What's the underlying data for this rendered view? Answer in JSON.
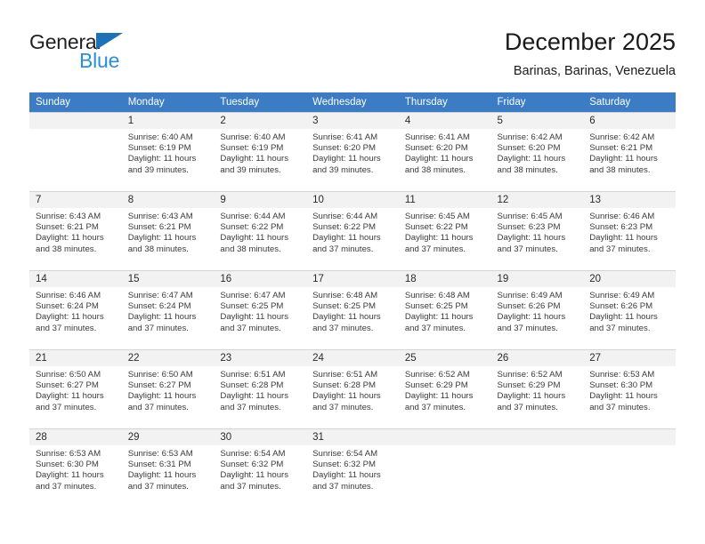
{
  "logo": {
    "word_one": "General",
    "word_two": "Blue",
    "triangle_icon": "blue-triangle-icon",
    "colors": {
      "dark": "#231f20",
      "blue": "#2a8fd8",
      "triangle": "#1b72b8"
    }
  },
  "header": {
    "title": "December 2025",
    "subtitle": "Barinas, Barinas, Venezuela"
  },
  "theme": {
    "header_row_bg": "#3b7cc4",
    "header_row_text": "#ffffff",
    "daynum_band_bg": "#f2f2f2",
    "cell_bg": "#ffffff",
    "grid_line": "#d4d4d4"
  },
  "calendar": {
    "weekday_headers": [
      "Sunday",
      "Monday",
      "Tuesday",
      "Wednesday",
      "Thursday",
      "Friday",
      "Saturday"
    ],
    "weeks": [
      [
        {
          "day": "",
          "sunrise": "",
          "sunset": "",
          "daylight_line1": "",
          "daylight_line2": ""
        },
        {
          "day": "1",
          "sunrise": "Sunrise: 6:40 AM",
          "sunset": "Sunset: 6:19 PM",
          "daylight_line1": "Daylight: 11 hours",
          "daylight_line2": "and 39 minutes."
        },
        {
          "day": "2",
          "sunrise": "Sunrise: 6:40 AM",
          "sunset": "Sunset: 6:19 PM",
          "daylight_line1": "Daylight: 11 hours",
          "daylight_line2": "and 39 minutes."
        },
        {
          "day": "3",
          "sunrise": "Sunrise: 6:41 AM",
          "sunset": "Sunset: 6:20 PM",
          "daylight_line1": "Daylight: 11 hours",
          "daylight_line2": "and 39 minutes."
        },
        {
          "day": "4",
          "sunrise": "Sunrise: 6:41 AM",
          "sunset": "Sunset: 6:20 PM",
          "daylight_line1": "Daylight: 11 hours",
          "daylight_line2": "and 38 minutes."
        },
        {
          "day": "5",
          "sunrise": "Sunrise: 6:42 AM",
          "sunset": "Sunset: 6:20 PM",
          "daylight_line1": "Daylight: 11 hours",
          "daylight_line2": "and 38 minutes."
        },
        {
          "day": "6",
          "sunrise": "Sunrise: 6:42 AM",
          "sunset": "Sunset: 6:21 PM",
          "daylight_line1": "Daylight: 11 hours",
          "daylight_line2": "and 38 minutes."
        }
      ],
      [
        {
          "day": "7",
          "sunrise": "Sunrise: 6:43 AM",
          "sunset": "Sunset: 6:21 PM",
          "daylight_line1": "Daylight: 11 hours",
          "daylight_line2": "and 38 minutes."
        },
        {
          "day": "8",
          "sunrise": "Sunrise: 6:43 AM",
          "sunset": "Sunset: 6:21 PM",
          "daylight_line1": "Daylight: 11 hours",
          "daylight_line2": "and 38 minutes."
        },
        {
          "day": "9",
          "sunrise": "Sunrise: 6:44 AM",
          "sunset": "Sunset: 6:22 PM",
          "daylight_line1": "Daylight: 11 hours",
          "daylight_line2": "and 38 minutes."
        },
        {
          "day": "10",
          "sunrise": "Sunrise: 6:44 AM",
          "sunset": "Sunset: 6:22 PM",
          "daylight_line1": "Daylight: 11 hours",
          "daylight_line2": "and 37 minutes."
        },
        {
          "day": "11",
          "sunrise": "Sunrise: 6:45 AM",
          "sunset": "Sunset: 6:22 PM",
          "daylight_line1": "Daylight: 11 hours",
          "daylight_line2": "and 37 minutes."
        },
        {
          "day": "12",
          "sunrise": "Sunrise: 6:45 AM",
          "sunset": "Sunset: 6:23 PM",
          "daylight_line1": "Daylight: 11 hours",
          "daylight_line2": "and 37 minutes."
        },
        {
          "day": "13",
          "sunrise": "Sunrise: 6:46 AM",
          "sunset": "Sunset: 6:23 PM",
          "daylight_line1": "Daylight: 11 hours",
          "daylight_line2": "and 37 minutes."
        }
      ],
      [
        {
          "day": "14",
          "sunrise": "Sunrise: 6:46 AM",
          "sunset": "Sunset: 6:24 PM",
          "daylight_line1": "Daylight: 11 hours",
          "daylight_line2": "and 37 minutes."
        },
        {
          "day": "15",
          "sunrise": "Sunrise: 6:47 AM",
          "sunset": "Sunset: 6:24 PM",
          "daylight_line1": "Daylight: 11 hours",
          "daylight_line2": "and 37 minutes."
        },
        {
          "day": "16",
          "sunrise": "Sunrise: 6:47 AM",
          "sunset": "Sunset: 6:25 PM",
          "daylight_line1": "Daylight: 11 hours",
          "daylight_line2": "and 37 minutes."
        },
        {
          "day": "17",
          "sunrise": "Sunrise: 6:48 AM",
          "sunset": "Sunset: 6:25 PM",
          "daylight_line1": "Daylight: 11 hours",
          "daylight_line2": "and 37 minutes."
        },
        {
          "day": "18",
          "sunrise": "Sunrise: 6:48 AM",
          "sunset": "Sunset: 6:25 PM",
          "daylight_line1": "Daylight: 11 hours",
          "daylight_line2": "and 37 minutes."
        },
        {
          "day": "19",
          "sunrise": "Sunrise: 6:49 AM",
          "sunset": "Sunset: 6:26 PM",
          "daylight_line1": "Daylight: 11 hours",
          "daylight_line2": "and 37 minutes."
        },
        {
          "day": "20",
          "sunrise": "Sunrise: 6:49 AM",
          "sunset": "Sunset: 6:26 PM",
          "daylight_line1": "Daylight: 11 hours",
          "daylight_line2": "and 37 minutes."
        }
      ],
      [
        {
          "day": "21",
          "sunrise": "Sunrise: 6:50 AM",
          "sunset": "Sunset: 6:27 PM",
          "daylight_line1": "Daylight: 11 hours",
          "daylight_line2": "and 37 minutes."
        },
        {
          "day": "22",
          "sunrise": "Sunrise: 6:50 AM",
          "sunset": "Sunset: 6:27 PM",
          "daylight_line1": "Daylight: 11 hours",
          "daylight_line2": "and 37 minutes."
        },
        {
          "day": "23",
          "sunrise": "Sunrise: 6:51 AM",
          "sunset": "Sunset: 6:28 PM",
          "daylight_line1": "Daylight: 11 hours",
          "daylight_line2": "and 37 minutes."
        },
        {
          "day": "24",
          "sunrise": "Sunrise: 6:51 AM",
          "sunset": "Sunset: 6:28 PM",
          "daylight_line1": "Daylight: 11 hours",
          "daylight_line2": "and 37 minutes."
        },
        {
          "day": "25",
          "sunrise": "Sunrise: 6:52 AM",
          "sunset": "Sunset: 6:29 PM",
          "daylight_line1": "Daylight: 11 hours",
          "daylight_line2": "and 37 minutes."
        },
        {
          "day": "26",
          "sunrise": "Sunrise: 6:52 AM",
          "sunset": "Sunset: 6:29 PM",
          "daylight_line1": "Daylight: 11 hours",
          "daylight_line2": "and 37 minutes."
        },
        {
          "day": "27",
          "sunrise": "Sunrise: 6:53 AM",
          "sunset": "Sunset: 6:30 PM",
          "daylight_line1": "Daylight: 11 hours",
          "daylight_line2": "and 37 minutes."
        }
      ],
      [
        {
          "day": "28",
          "sunrise": "Sunrise: 6:53 AM",
          "sunset": "Sunset: 6:30 PM",
          "daylight_line1": "Daylight: 11 hours",
          "daylight_line2": "and 37 minutes."
        },
        {
          "day": "29",
          "sunrise": "Sunrise: 6:53 AM",
          "sunset": "Sunset: 6:31 PM",
          "daylight_line1": "Daylight: 11 hours",
          "daylight_line2": "and 37 minutes."
        },
        {
          "day": "30",
          "sunrise": "Sunrise: 6:54 AM",
          "sunset": "Sunset: 6:32 PM",
          "daylight_line1": "Daylight: 11 hours",
          "daylight_line2": "and 37 minutes."
        },
        {
          "day": "31",
          "sunrise": "Sunrise: 6:54 AM",
          "sunset": "Sunset: 6:32 PM",
          "daylight_line1": "Daylight: 11 hours",
          "daylight_line2": "and 37 minutes."
        },
        {
          "day": "",
          "sunrise": "",
          "sunset": "",
          "daylight_line1": "",
          "daylight_line2": ""
        },
        {
          "day": "",
          "sunrise": "",
          "sunset": "",
          "daylight_line1": "",
          "daylight_line2": ""
        },
        {
          "day": "",
          "sunrise": "",
          "sunset": "",
          "daylight_line1": "",
          "daylight_line2": ""
        }
      ]
    ]
  }
}
